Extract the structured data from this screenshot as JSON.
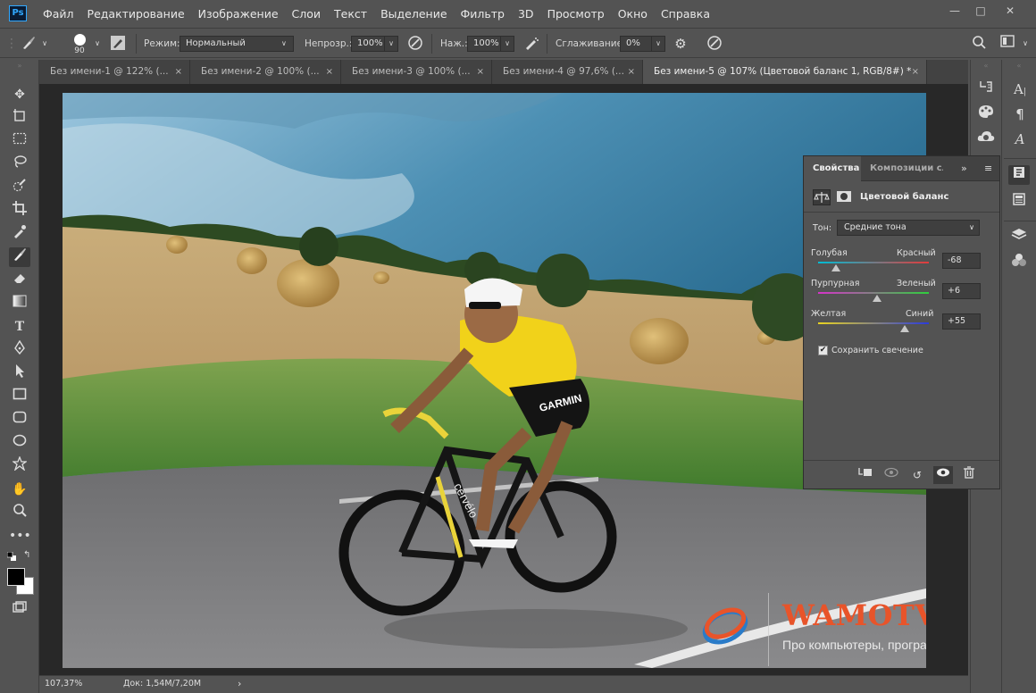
{
  "app": {
    "logo": "Ps"
  },
  "menu": [
    "Файл",
    "Редактирование",
    "Изображение",
    "Слои",
    "Текст",
    "Выделение",
    "Фильтр",
    "3D",
    "Просмотр",
    "Окно",
    "Справка"
  ],
  "window_controls": {
    "minimize": "—",
    "maximize": "□",
    "close": "✕"
  },
  "options": {
    "brush_size": "90",
    "mode_label": "Режим:",
    "mode_value": "Нормальный",
    "opacity_label": "Непрозр.:",
    "opacity_value": "100%",
    "flow_label": "Наж.:",
    "flow_value": "100%",
    "smoothing_label": "Сглаживание:",
    "smoothing_value": "0%"
  },
  "tabs": [
    {
      "label": "Без имени-1 @ 122% (...",
      "close": "×"
    },
    {
      "label": "Без имени-2 @ 100% (...",
      "close": "×"
    },
    {
      "label": "Без имени-3 @ 100% (...",
      "close": "×"
    },
    {
      "label": "Без имени-4 @ 97,6% (...",
      "close": "×"
    },
    {
      "label": "Без имени-5 @ 107% (Цветовой баланс 1, RGB/8#) *",
      "close": "×"
    }
  ],
  "status": {
    "zoom": "107,37%",
    "doc": "Док: 1,54M/7,20M",
    "arrow": "›"
  },
  "properties": {
    "tab_active": "Свойства",
    "tab_other": "Композиции слоё",
    "title": "Цветовой баланс",
    "tone_label": "Тон:",
    "tone_value": "Средние тона",
    "sliders": [
      {
        "left": "Голубая",
        "right": "Красный",
        "value": "-68",
        "position": 0.16
      },
      {
        "left": "Пурпурная",
        "right": "Зеленый",
        "value": "+6",
        "position": 0.53
      },
      {
        "left": "Желтая",
        "right": "Синий",
        "value": "+55",
        "position": 0.78
      }
    ],
    "preserve_label": "Сохранить свечение",
    "preserve_checked": true
  },
  "watermark": {
    "brand": "WAMOTVET.RU",
    "tagline": "Про компьютеры, программы и сайты"
  },
  "photo": {
    "jersey_text": "GARMIN",
    "bike_text": "cervélo"
  }
}
